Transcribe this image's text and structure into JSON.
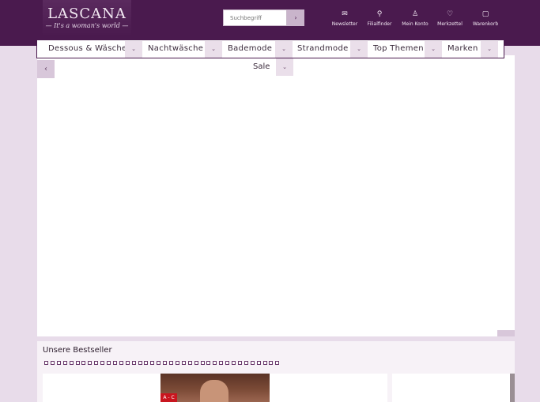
{
  "brand": {
    "name": "LASCANA",
    "tagline": "— It's a woman's world —"
  },
  "search": {
    "placeholder": "Suchbegriff",
    "button": "›"
  },
  "header_nav": [
    {
      "label": "Newsletter",
      "icon": "✉"
    },
    {
      "label": "Filialfinder",
      "icon": "⚲"
    },
    {
      "label": "Mein Konto",
      "icon": "♙"
    },
    {
      "label": "Merkzettel",
      "icon": "♡"
    },
    {
      "label": "Warenkorb",
      "icon": "▢"
    }
  ],
  "menu": [
    {
      "label": "Dessous & Wäsche",
      "arrow": "⌄"
    },
    {
      "label": "Nachtwäsche",
      "arrow": "⌄"
    },
    {
      "label": "Bademode",
      "arrow": "⌄"
    },
    {
      "label": "Strandmode",
      "arrow": "⌄"
    },
    {
      "label": "Top Themen",
      "arrow": "⌄"
    },
    {
      "label": "Marken",
      "arrow": "⌄"
    },
    {
      "label": "Sale",
      "arrow": "⌄"
    }
  ],
  "slider": {
    "prev": "‹"
  },
  "bestseller": {
    "title": "Unsere Bestseller",
    "badge": "A - C"
  },
  "colors": {
    "header_bg": "#4a1a4e",
    "page_bg": "#e8dcea",
    "accent": "#c9161f"
  }
}
